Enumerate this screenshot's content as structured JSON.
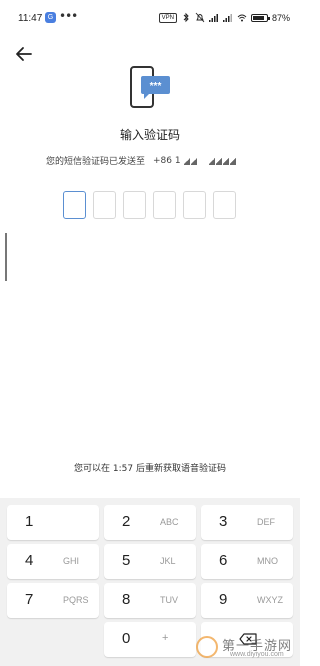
{
  "status_bar": {
    "time": "11:47",
    "app_icon_letter": "G",
    "more": "•••",
    "vpn": "VPN",
    "battery": "87%"
  },
  "header": {
    "back_icon": "arrow-left-icon"
  },
  "illustration": {
    "icon": "phone-sms-icon",
    "bubble_text": "***"
  },
  "main": {
    "title": "输入验证码",
    "subtitle_prefix": "您的短信验证码已发送至",
    "phone_prefix": "+86 1",
    "code_boxes": [
      "",
      "",
      "",
      "",
      "",
      ""
    ],
    "resend_text": "您可以在 1:57 后重新获取语音验证码"
  },
  "keypad": {
    "keys": [
      {
        "num": "1",
        "letters": ""
      },
      {
        "num": "2",
        "letters": "ABC"
      },
      {
        "num": "3",
        "letters": "DEF"
      },
      {
        "num": "4",
        "letters": "GHI"
      },
      {
        "num": "5",
        "letters": "JKL"
      },
      {
        "num": "6",
        "letters": "MNO"
      },
      {
        "num": "7",
        "letters": "PQRS"
      },
      {
        "num": "8",
        "letters": "TUV"
      },
      {
        "num": "9",
        "letters": "WXYZ"
      },
      {
        "num": "0",
        "letters": "+"
      }
    ],
    "delete_icon": "backspace-icon"
  },
  "watermark": {
    "text": "第一手游网",
    "url": "www.diyiyou.com"
  },
  "colors": {
    "accent": "#5b8fd1",
    "keypad_bg": "#f1f1f1",
    "key_bg": "#ffffff"
  }
}
